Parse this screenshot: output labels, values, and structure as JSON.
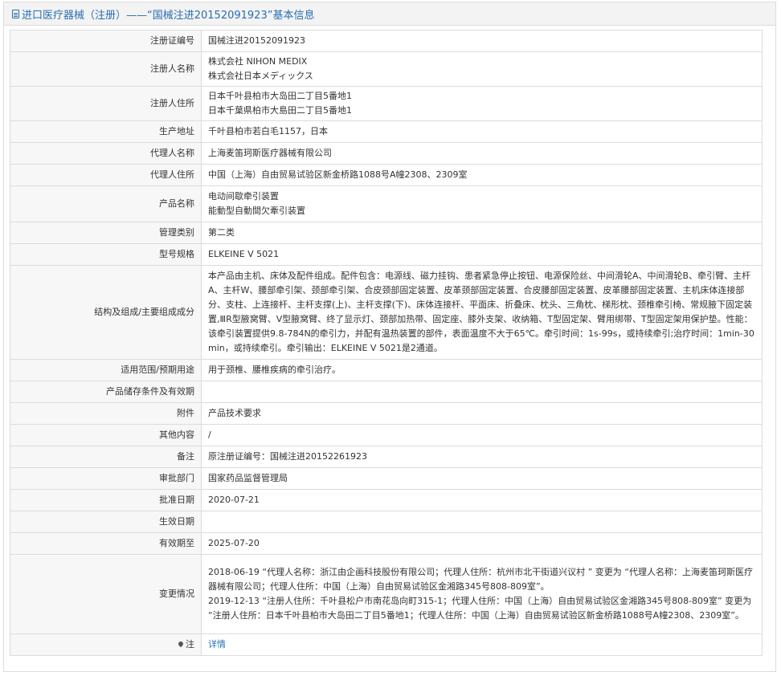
{
  "header": {
    "title": "进口医疗器械（注册）——“国械注进20152091923”基本信息"
  },
  "rows": {
    "reg_no": {
      "label": "注册证编号",
      "value": "国械注进20152091923"
    },
    "registrant_name": {
      "label": "注册人名称",
      "value_1": "株式会社 NIHON MEDIX",
      "value_2": "株式会社日本メディックス"
    },
    "registrant_address": {
      "label": "注册人住所",
      "value_1": "日本千叶县柏市大岛田二丁目5番地1",
      "value_2": "日本千葉県柏市大島田二丁目5番地1"
    },
    "production_address": {
      "label": "生产地址",
      "value": "千叶县柏市若白毛1157，日本"
    },
    "agent_name": {
      "label": "代理人名称",
      "value": "上海麦笛珂斯医疗器械有限公司"
    },
    "agent_address": {
      "label": "代理人住所",
      "value": "中国（上海）自由贸易试验区新金桥路1088号A幢2308、2309室"
    },
    "product_name": {
      "label": "产品名称",
      "value_1": "电动间歇牵引装置",
      "value_2": "能動型自動間欠牽引装置"
    },
    "category": {
      "label": "管理类别",
      "value": "第二类"
    },
    "model": {
      "label": "型号规格",
      "value": "ELKEINE V 5021"
    },
    "structure": {
      "label": "结构及组成/主要组成成分",
      "value": "本产品由主机、床体及配件组成。配件包含：电源线、磁力挂钩、患者紧急停止按钮、电源保险丝、中间滑轮A、中间滑轮B、牵引臂、主杆A、主杆W、腰部牵引架、颈部牵引架、合皮颈部固定装置、皮革颈部固定装置、合皮腰部固定装置、皮革腰部固定装置、主机床体连接部分、支柱、上连接杆、主杆支撑(上)、主杆支撑(下)、床体连接杆、平面床、折叠床、枕头、三角枕、梯形枕、颈椎牵引椅、常规腋下固定装置,ⅢR型腋窝臂、V型腋窝臂、终了显示灯、颈部加热带、固定座、膝外支架、收纳箱、T型固定架、臂用绑带、T型固定架用保护垫。性能：该牵引装置提供9.8-784N的牵引力，并配有温热装置的部件，表面温度不大于65℃。牵引时间：1s-99s，或持续牵引;治疗时间：1min-30min，或持续牵引。牵引输出：ELKEINE V 5021是2通道。"
    },
    "scope": {
      "label": "适用范围/预期用途",
      "value": "用于颈椎、腰椎疾病的牵引治疗。"
    },
    "storage": {
      "label": "产品储存条件及有效期",
      "value": ""
    },
    "attachment": {
      "label": "附件",
      "value": "产品技术要求"
    },
    "other": {
      "label": "其他内容",
      "value": "/"
    },
    "remark": {
      "label": "备注",
      "value": "原注册证编号：国械注进20152261923"
    },
    "approval_dept": {
      "label": "审批部门",
      "value": "国家药品监督管理局"
    },
    "approval_date": {
      "label": "批准日期",
      "value": "2020-07-21"
    },
    "effective_date": {
      "label": "生效日期",
      "value": ""
    },
    "expiry_date": {
      "label": "有效期至",
      "value": "2025-07-20"
    },
    "changes": {
      "label": "变更情况",
      "value_1": "2018-06-19 “代理人名称：浙江由企画科技股份有限公司；代理人住所：杭州市北干街道兴议村 ” 变更为 “代理人名称：上海麦笛珂斯医疗器械有限公司；代理人住所：中国（上海）自由贸易试验区金湘路345号808-809室”。",
      "value_2": "2019-12-13 “注册人住所：千叶县松户市南花岛向町315-1；代理人住所：中国（上海）自由贸易试验区金湘路345号808-809室” 变更为 “注册人住所：日本千叶县柏市大岛田二丁目5番地1；代理人住所：中国（上海）自由贸易试验区新金桥路1088号A幢2308、2309室”。"
    },
    "note": {
      "label": "注",
      "value": "详情"
    }
  },
  "icons": {
    "header": "document-icon",
    "note": "pin-icon"
  },
  "colors": {
    "accent": "#2a6db0",
    "label_bg": "#f7f7f7",
    "border": "#dcdcdc"
  }
}
